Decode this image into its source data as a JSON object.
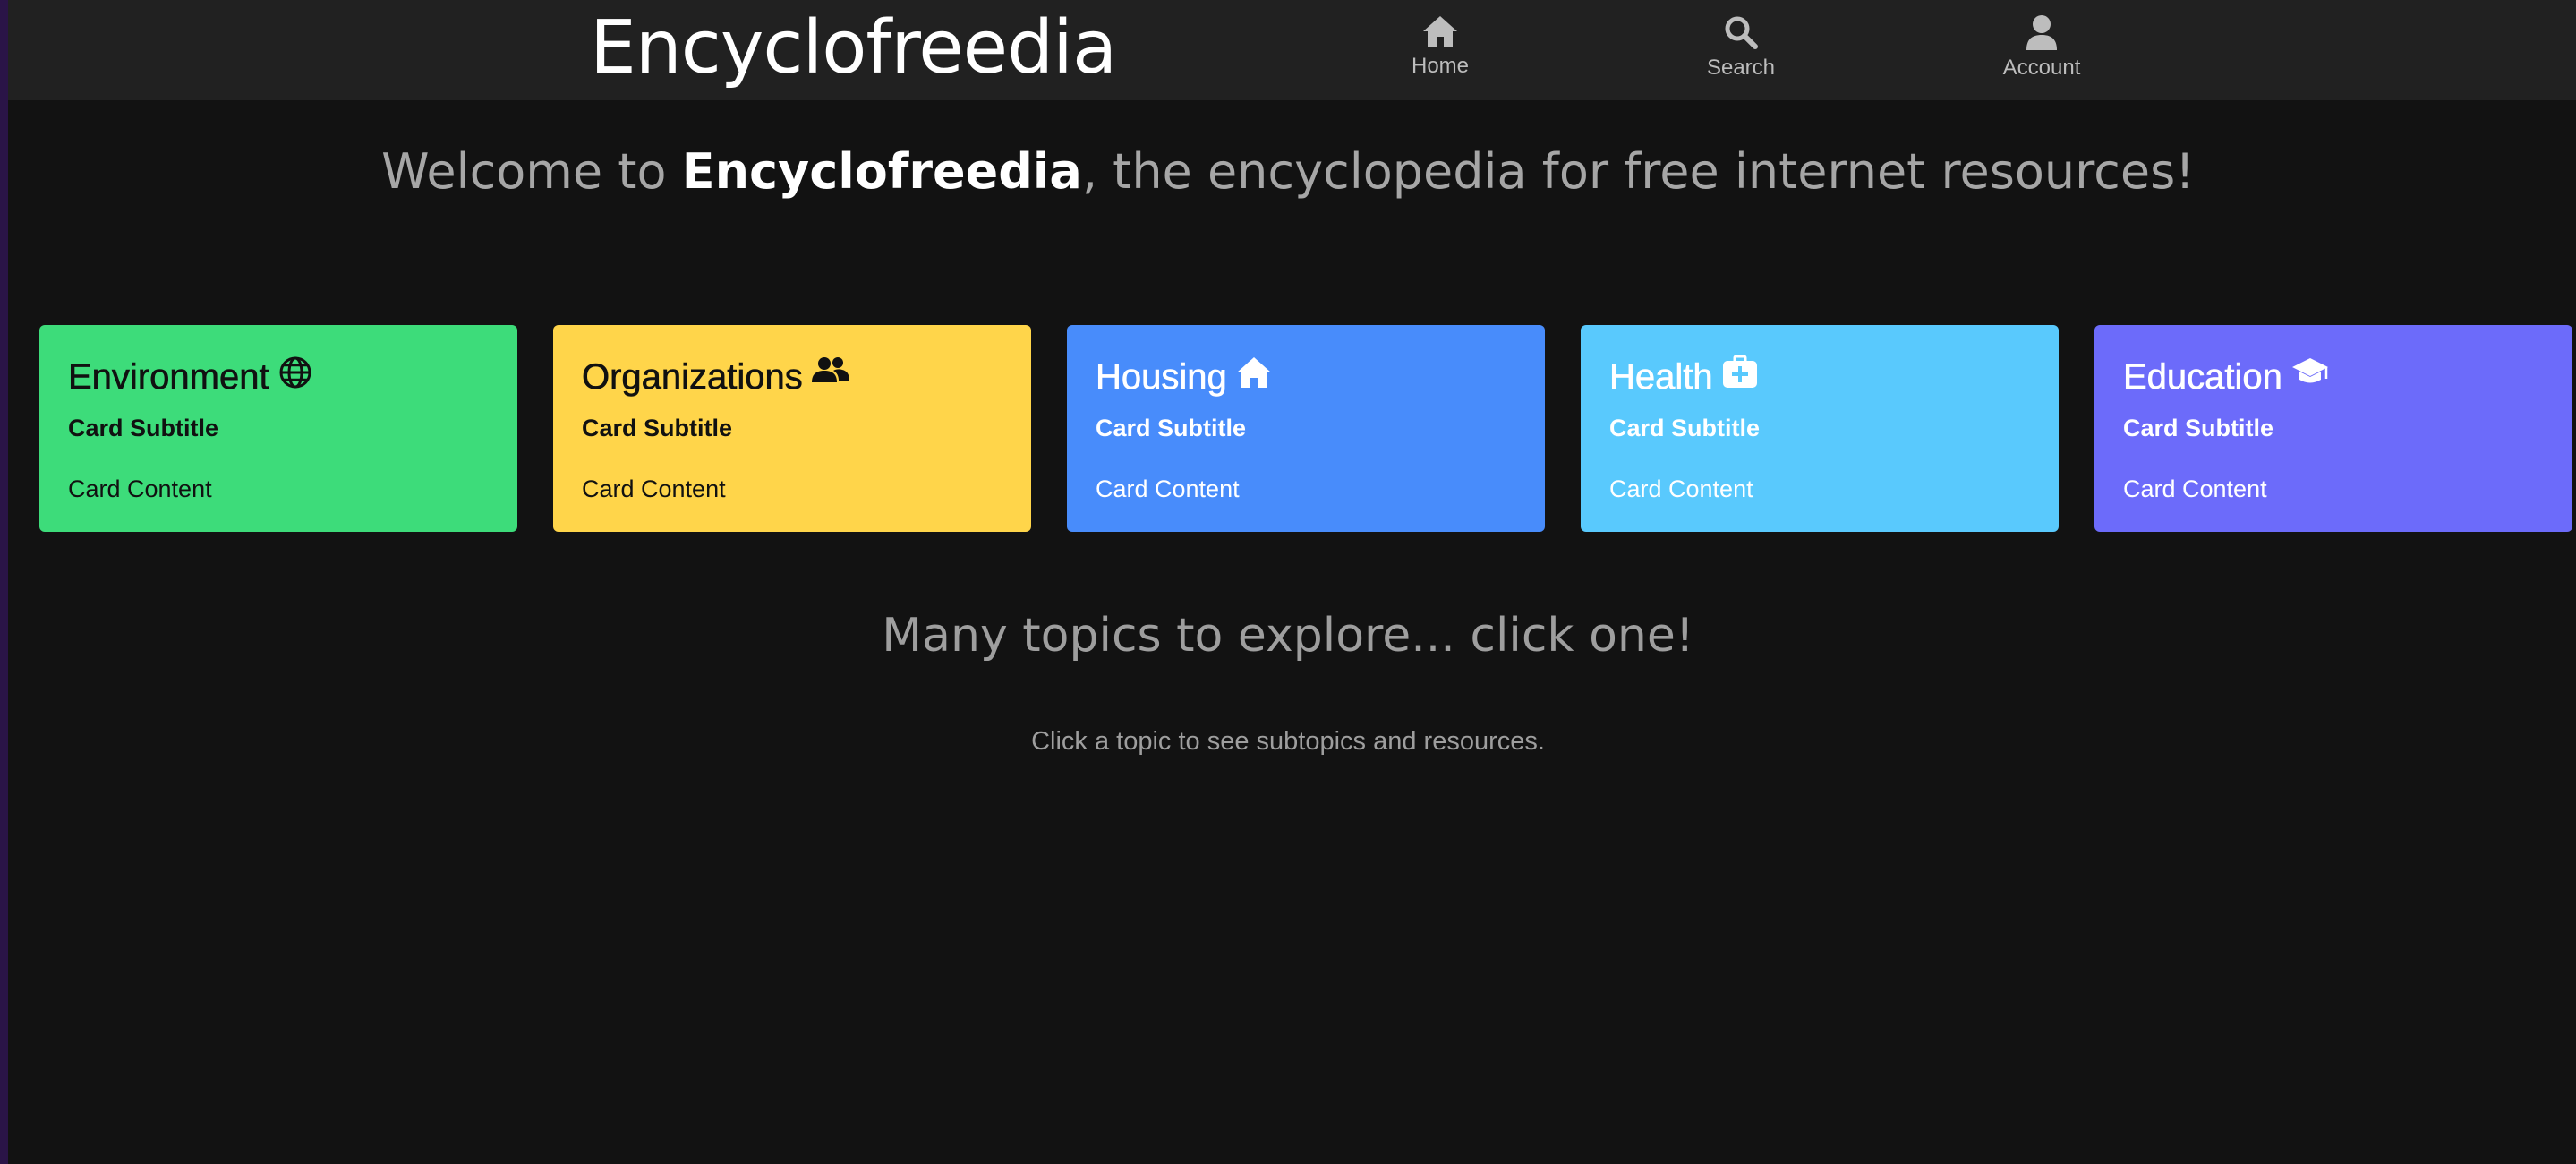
{
  "header": {
    "brand": "Encyclofreedia",
    "nav": [
      {
        "label": "Home",
        "icon": "home-icon"
      },
      {
        "label": "Search",
        "icon": "search-icon"
      },
      {
        "label": "Account",
        "icon": "account-icon"
      }
    ]
  },
  "welcome": {
    "prefix": "Welcome to ",
    "brand": "Encyclofreedia",
    "suffix": ", the encyclopedia for free internet resources!"
  },
  "cards": [
    {
      "title": "Environment",
      "icon": "globe-icon",
      "subtitle": "Card Subtitle",
      "content": "Card Content",
      "color": "#3ddc7a"
    },
    {
      "title": "Organizations",
      "icon": "people-icon",
      "subtitle": "Card Subtitle",
      "content": "Card Content",
      "color": "#ffd54a"
    },
    {
      "title": "Housing",
      "icon": "house-icon",
      "subtitle": "Card Subtitle",
      "content": "Card Content",
      "color": "#488cfb"
    },
    {
      "title": "Health",
      "icon": "medkit-icon",
      "subtitle": "Card Subtitle",
      "content": "Card Content",
      "color": "#59c9fd"
    },
    {
      "title": "Education",
      "icon": "graduation-cap-icon",
      "subtitle": "Card Subtitle",
      "content": "Card Content",
      "color": "#6c6bfa"
    }
  ],
  "topics_heading": "Many topics to explore... click one!",
  "topics_hint": "Click a topic to see subtopics and resources."
}
